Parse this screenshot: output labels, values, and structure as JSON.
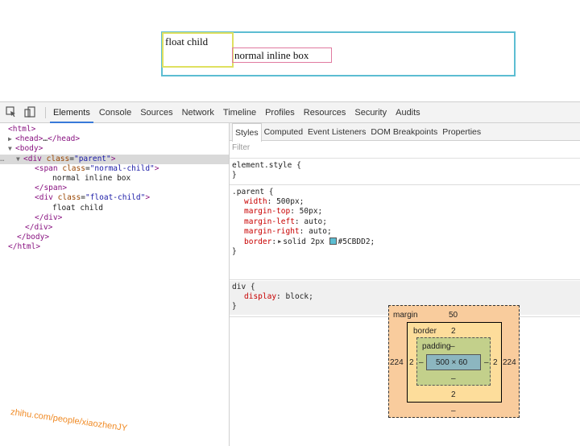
{
  "page": {
    "float_child_text": "float child",
    "normal_child_text": "normal inline box",
    "parent_border_color": "#5CBDD2",
    "float_border_color": "#dfe060",
    "inline_border_color": "#e07aa0"
  },
  "toolbar": {
    "tabs": [
      "Elements",
      "Console",
      "Sources",
      "Network",
      "Timeline",
      "Profiles",
      "Resources",
      "Security",
      "Audits"
    ],
    "active_tab": "Elements",
    "icons": [
      "inspect-icon",
      "device-mode-icon"
    ]
  },
  "dom": {
    "html_open": "<html>",
    "head_tag": "<head>",
    "head_ellipsis": "…",
    "head_close": "</head>",
    "body_open": "<body>",
    "dots": "…",
    "div_open_tag": "<div",
    "div_attr": "class",
    "div_attr_val": "\"parent\"",
    "div_open_end": ">",
    "span_open_tag": "<span",
    "span_attr": "class",
    "span_attr_val": "\"normal-child\"",
    "span_open_end": ">",
    "span_text": "normal inline box",
    "span_close": "</span>",
    "float_open_tag": "<div",
    "float_attr": "class",
    "float_attr_val": "\"float-child\"",
    "float_open_end": ">",
    "float_text": "float child",
    "float_close": "</div>",
    "div_close": "</div>",
    "body_close": "</body>",
    "html_close": "</html>"
  },
  "styles": {
    "subtabs": [
      "Styles",
      "Computed",
      "Event Listeners",
      "DOM Breakpoints",
      "Properties"
    ],
    "active_subtab": "Styles",
    "filter_placeholder": "Filter",
    "element_style_selector": "element.style {",
    "close_brace": "}",
    "parent_selector": ".parent {",
    "parent_props": [
      {
        "name": "width",
        "value": "500px;"
      },
      {
        "name": "margin-top",
        "value": "50px;"
      },
      {
        "name": "margin-left",
        "value": "auto;"
      },
      {
        "name": "margin-right",
        "value": "auto;"
      }
    ],
    "border_prop": {
      "name": "border",
      "value_a": "solid 2px",
      "value_b": "#5CBDD2;"
    },
    "div_selector": "div {",
    "div_prop": {
      "name": "display",
      "value": "block;"
    }
  },
  "box_model": {
    "margin_label": "margin",
    "margin_top": "50",
    "margin_left": "224",
    "margin_right": "224",
    "margin_bottom": "–",
    "border_label": "border",
    "border_top": "2",
    "border_left": "2",
    "border_right": "2",
    "border_bottom": "2",
    "padding_label": "padding",
    "padding_top": "–",
    "padding_left": "–",
    "padding_right": "–",
    "padding_bottom": "–",
    "content_size": "500 × 60"
  },
  "watermark": "zhihu.com/people/xiaozhenJY"
}
